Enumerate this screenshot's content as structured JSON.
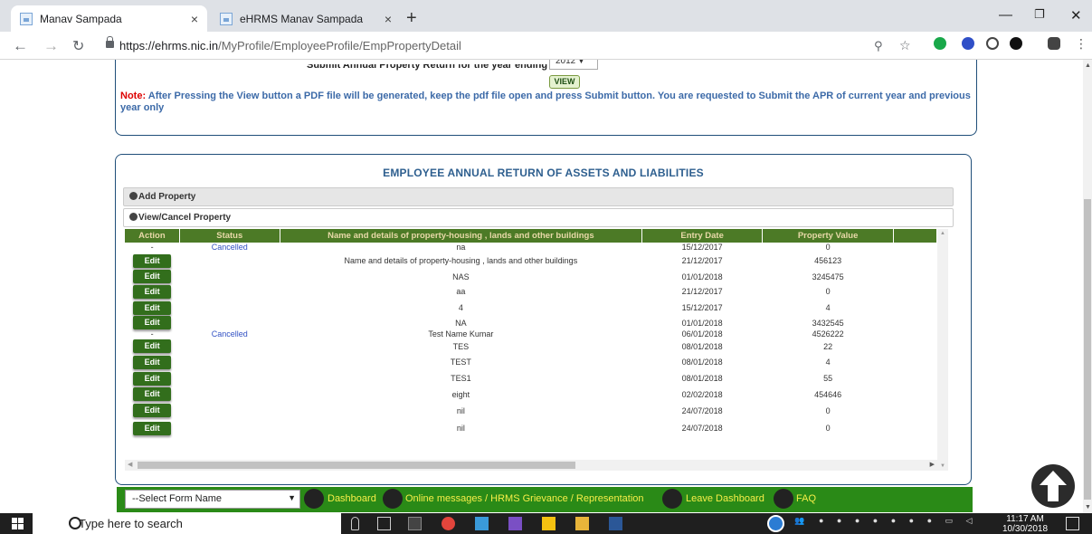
{
  "browser": {
    "tabs": [
      {
        "title": "Manav Sampada",
        "active": true
      },
      {
        "title": "eHRMS Manav Sampada",
        "active": false
      }
    ],
    "url_host": "https://ehrms.nic.in",
    "url_path": "/MyProfile/EmployeeProfile/EmpPropertyDetail"
  },
  "apr": {
    "label": "Submit Annual Property Return for the year ending",
    "year": "2012",
    "view_label": "VIEW"
  },
  "note": {
    "lead": "Note:",
    "text": " After Pressing the View button a PDF file will be generated, keep the pdf file open and press Submit button. You are requested to Submit the APR of current year and previous year only"
  },
  "panel": {
    "title": "EMPLOYEE ANNUAL RETURN OF ASSETS AND LIABILITIES",
    "add_property": "Add Property",
    "view_cancel": "View/Cancel Property"
  },
  "table": {
    "columns": [
      "Action",
      "Status",
      "Name and details of property-housing , lands and other buildings",
      "Entry Date",
      "Property Value",
      ""
    ],
    "edit_label": "Edit",
    "rows": [
      {
        "action": "-",
        "status": "Cancelled",
        "name": "na",
        "date": "15/12/2017",
        "value": "0"
      },
      {
        "action": "Edit",
        "status": "",
        "name": "Name and details of property-housing , lands and other buildings",
        "date": "21/12/2017",
        "value": "456123"
      },
      {
        "action": "Edit",
        "status": "",
        "name": "NAS",
        "date": "01/01/2018",
        "value": "3245475"
      },
      {
        "action": "Edit",
        "status": "",
        "name": "aa",
        "date": "21/12/2017",
        "value": "0"
      },
      {
        "action": "Edit",
        "status": "",
        "name": "4",
        "date": "15/12/2017",
        "value": "4"
      },
      {
        "action": "Edit",
        "status": "",
        "name": "NA",
        "date": "01/01/2018",
        "value": "3432545"
      },
      {
        "action": "-",
        "status": "Cancelled",
        "name": "Test Name Kumar",
        "date": "06/01/2018",
        "value": "4526222"
      },
      {
        "action": "Edit",
        "status": "",
        "name": "TES",
        "date": "08/01/2018",
        "value": "22"
      },
      {
        "action": "Edit",
        "status": "",
        "name": "TEST",
        "date": "08/01/2018",
        "value": "4"
      },
      {
        "action": "Edit",
        "status": "",
        "name": "TES1",
        "date": "08/01/2018",
        "value": "55"
      },
      {
        "action": "Edit",
        "status": "",
        "name": "eight",
        "date": "02/02/2018",
        "value": "454646"
      },
      {
        "action": "Edit",
        "status": "",
        "name": "nil",
        "date": "24/07/2018",
        "value": "0"
      },
      {
        "action": "Edit",
        "status": "",
        "name": "nil",
        "date": "24/07/2018",
        "value": "0"
      }
    ]
  },
  "footer": {
    "select_value": "--Select Form Name",
    "dashboard": "Dashboard",
    "messages": "Online messages / HRMS Grievance / Representation",
    "leave": "Leave Dashboard",
    "faq": "FAQ"
  },
  "taskbar": {
    "search_placeholder": "Type here to search",
    "time": "11:17 AM",
    "date": "10/30/2018"
  },
  "colors": {
    "header_green": "#4c7a26",
    "footer_green": "#2a8a17",
    "note_red": "#dd0000",
    "title_blue": "#2e5f8f"
  }
}
